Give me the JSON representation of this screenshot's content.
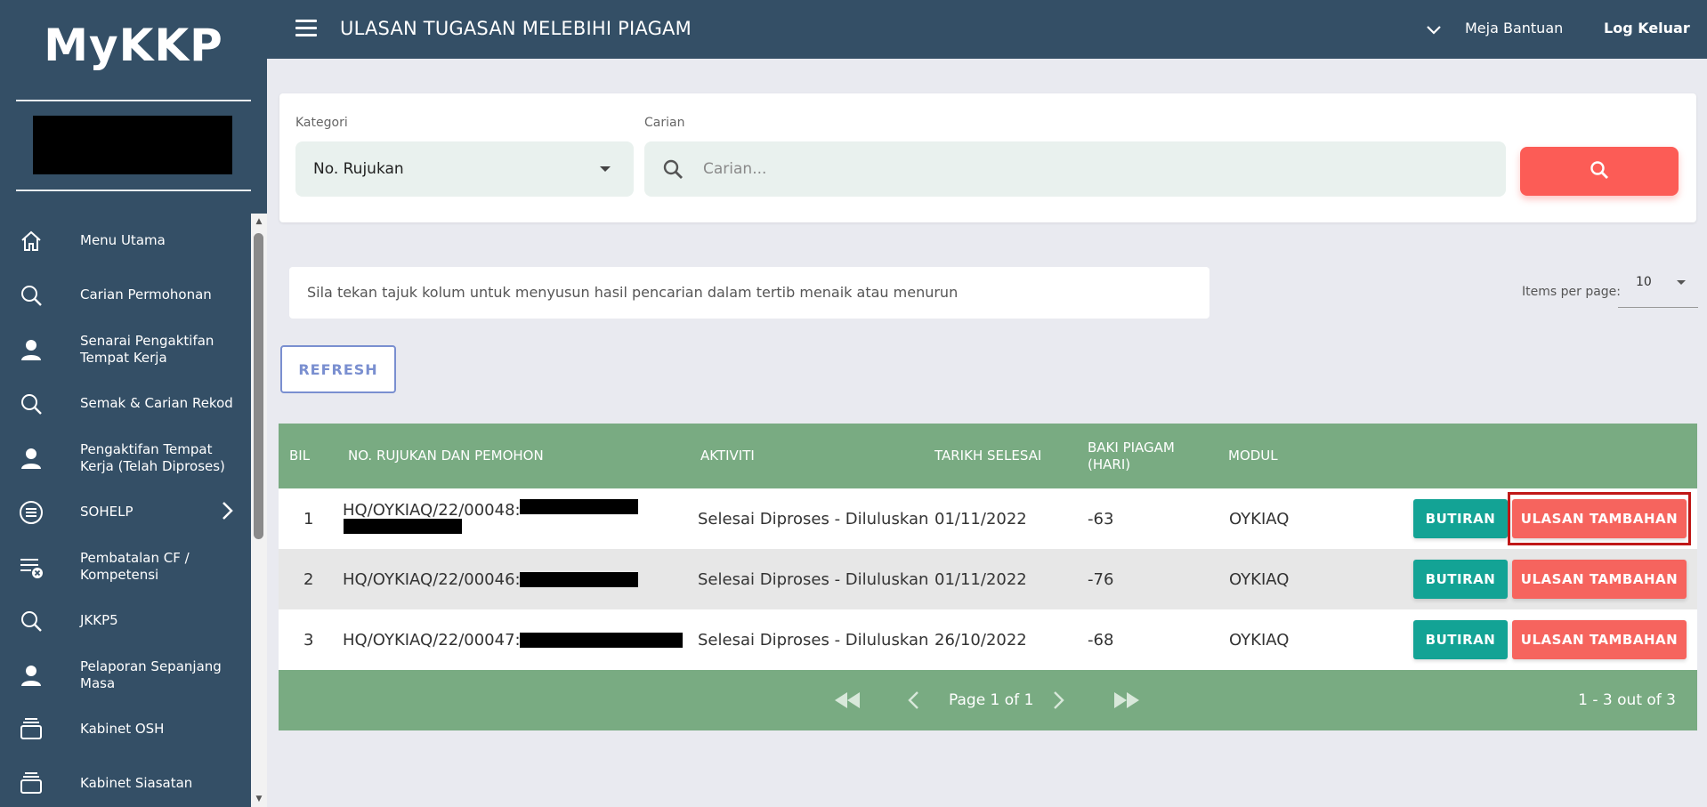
{
  "app": {
    "logo": "MyKKP",
    "page_title": "ULASAN TUGASAN MELEBIHI PIAGAM"
  },
  "header": {
    "help": "Meja Bantuan",
    "logout": "Log Keluar"
  },
  "sidebar": {
    "items": [
      {
        "label": "Menu Utama",
        "icon": "home-icon"
      },
      {
        "label": "Carian Permohonan",
        "icon": "search-icon"
      },
      {
        "label": "Senarai Pengaktifan Tempat Kerja",
        "icon": "person-icon"
      },
      {
        "label": "Semak & Carian Rekod",
        "icon": "search-icon"
      },
      {
        "label": "Pengaktifan Tempat Kerja (Telah Diproses)",
        "icon": "person-icon"
      },
      {
        "label": "SOHELP",
        "icon": "list-circle-icon"
      },
      {
        "label": "Pembatalan CF / Kompetensi",
        "icon": "list-cancel-icon"
      },
      {
        "label": "JKKP5",
        "icon": "search-icon"
      },
      {
        "label": "Pelaporan Sepanjang Masa",
        "icon": "person-icon"
      },
      {
        "label": "Kabinet OSH",
        "icon": "cabinet-icon"
      },
      {
        "label": "Kabinet Siasatan",
        "icon": "cabinet-icon"
      }
    ]
  },
  "search": {
    "category_label": "Kategori",
    "category_value": "No. Rujukan",
    "query_label": "Carian",
    "query_placeholder": "Carian...",
    "query_value": ""
  },
  "hint": "Sila tekan tajuk kolum untuk menyusun hasil pencarian dalam tertib menaik atau menurun",
  "paging": {
    "items_per_page_label": "Items per page:",
    "items_per_page": "10",
    "page_label": "Page 1 of 1",
    "range_label": "1 - 3 out of 3"
  },
  "refresh_label": "REFRESH",
  "table": {
    "headers": {
      "bil": "BIL",
      "ref": "NO. RUJUKAN DAN PEMOHON",
      "activity": "AKTIVITI",
      "end_date": "TARIKH SELESAI",
      "baki": "BAKI PIAGAM (HARI)",
      "module": "MODUL"
    },
    "detail_label": "BUTIRAN",
    "review_label": "ULASAN TAMBAHAN",
    "rows": [
      {
        "bil": "1",
        "ref": "HQ/OYKIAQ/22/00048:",
        "activity": "Selesai Diproses - Diluluskan",
        "end_date": "01/11/2022",
        "baki": "-63",
        "module": "OYKIAQ"
      },
      {
        "bil": "2",
        "ref": "HQ/OYKIAQ/22/00046:",
        "activity": "Selesai Diproses - Diluluskan",
        "end_date": "01/11/2022",
        "baki": "-76",
        "module": "OYKIAQ"
      },
      {
        "bil": "3",
        "ref": "HQ/OYKIAQ/22/00047:",
        "activity": "Selesai Diproses - Diluluskan",
        "end_date": "26/10/2022",
        "baki": "-68",
        "module": "OYKIAQ"
      }
    ]
  },
  "colors": {
    "primary": "#344f66",
    "table_header": "#79ab82",
    "teal_button": "#13a395",
    "coral_button": "#f6645e",
    "search_button": "#fc5c56",
    "highlight": "#c01818"
  }
}
